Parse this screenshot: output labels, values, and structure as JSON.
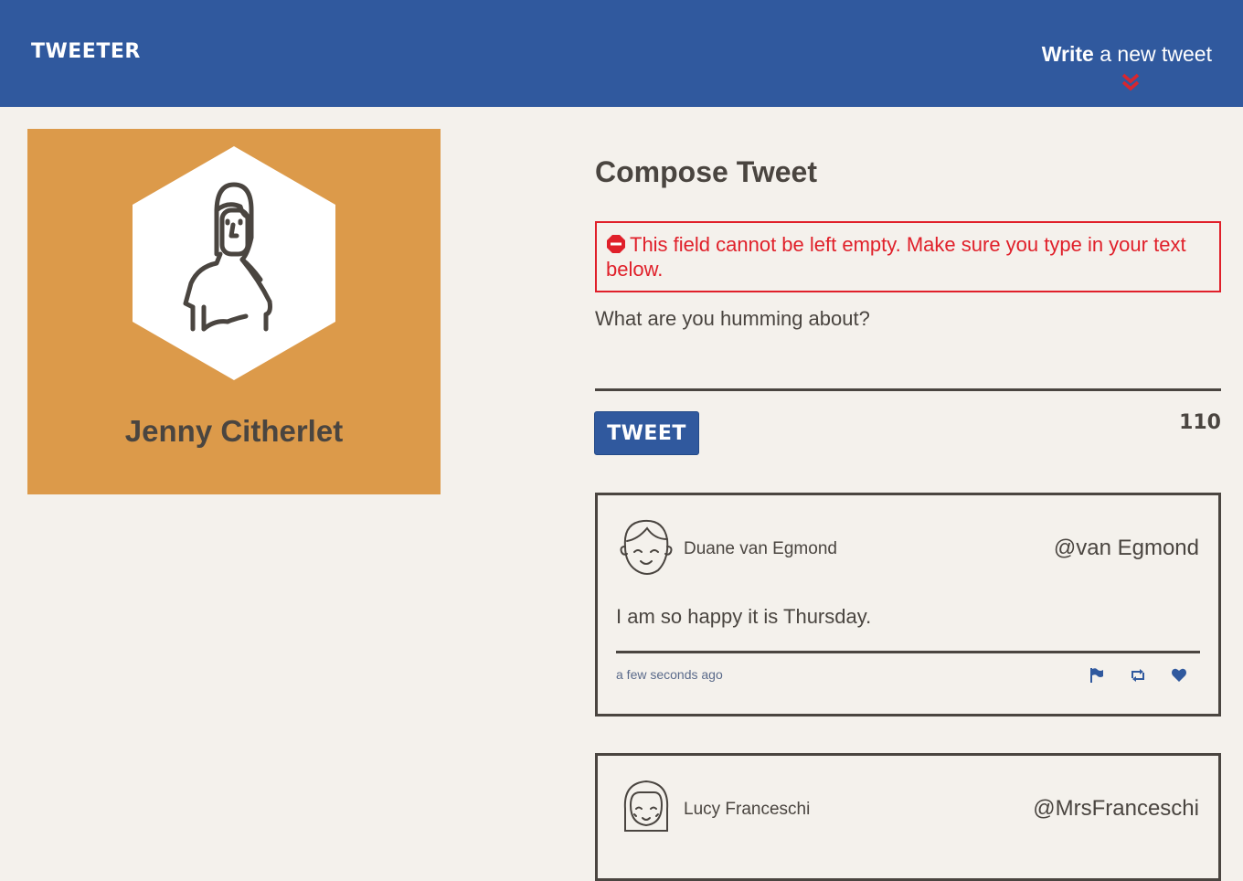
{
  "nav": {
    "logo": "TWEETER",
    "write_bold": "Write",
    "write_rest": " a new tweet"
  },
  "profile": {
    "name": "Jenny Citherlet",
    "background": "#dc9a4a"
  },
  "compose": {
    "title": "Compose Tweet",
    "error": "This field cannot be left empty. Make sure you type in your text below.",
    "placeholder": "What are you humming about?",
    "button": "TWEET",
    "counter": "110"
  },
  "tweets": [
    {
      "author": "Duane van Egmond",
      "handle": "@van Egmond",
      "text": "I am so happy it is Thursday.",
      "time": "a few seconds ago",
      "actions": [
        "flag-icon",
        "retweet-icon",
        "heart-icon"
      ]
    },
    {
      "author": "Lucy Franceschi",
      "handle": "@MrsFranceschi"
    }
  ],
  "colors": {
    "nav": "#30599e",
    "background": "#f4f1ec",
    "text": "#4a4540",
    "error": "#e0202a",
    "accent_red": "#d8262f"
  }
}
